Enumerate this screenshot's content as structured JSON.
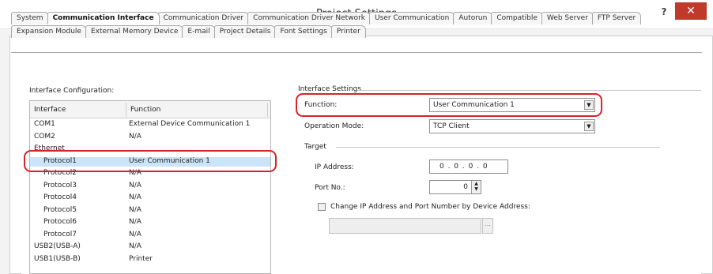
{
  "window": {
    "title": "Project Settings",
    "help": "?",
    "close": "✕"
  },
  "tabs": {
    "row1": [
      "System",
      "Communication Interface",
      "Communication Driver",
      "Communication Driver Network",
      "User Communication",
      "Autorun",
      "Compatible",
      "Web Server",
      "FTP Server"
    ],
    "row2": [
      "Expansion Module",
      "External Memory Device",
      "E-mail",
      "Project Details",
      "Font Settings",
      "Printer"
    ],
    "active": "Communication Interface"
  },
  "interface_config": {
    "label": "Interface Configuration:",
    "columns": [
      "Interface",
      "Function"
    ],
    "rows": [
      {
        "interface": "COM1",
        "function": "External Device Communication 1"
      },
      {
        "interface": "COM2",
        "function": "N/A"
      },
      {
        "interface": "Ethernet",
        "function": ""
      },
      {
        "interface": "Protocol1",
        "function": "User Communication 1"
      },
      {
        "interface": "Protocol2",
        "function": "N/A"
      },
      {
        "interface": "Protocol3",
        "function": "N/A"
      },
      {
        "interface": "Protocol4",
        "function": "N/A"
      },
      {
        "interface": "Protocol5",
        "function": "N/A"
      },
      {
        "interface": "Protocol6",
        "function": "N/A"
      },
      {
        "interface": "Protocol7",
        "function": "N/A"
      },
      {
        "interface": "USB2(USB-A)",
        "function": "N/A"
      },
      {
        "interface": "USB1(USB-B)",
        "function": "Printer"
      }
    ],
    "selected": "Protocol1"
  },
  "interface_settings": {
    "group_label": "Interface Settings",
    "function_label": "Function:",
    "function_value": "User Communication 1",
    "operation_mode_label": "Operation Mode:",
    "operation_mode_value": "TCP Client",
    "target_label": "Target",
    "ip_label": "IP Address:",
    "ip_value": "0 . 0 . 0 . 0",
    "port_label": "Port No.:",
    "port_value": "0",
    "change_checkbox_label": "Change IP Address and Port Number by Device Address:",
    "change_checked": false,
    "ellipsis": "..."
  },
  "colors": {
    "callout": "#d8232a",
    "close_button": "#c0392b",
    "selection": "#cce4f7"
  }
}
